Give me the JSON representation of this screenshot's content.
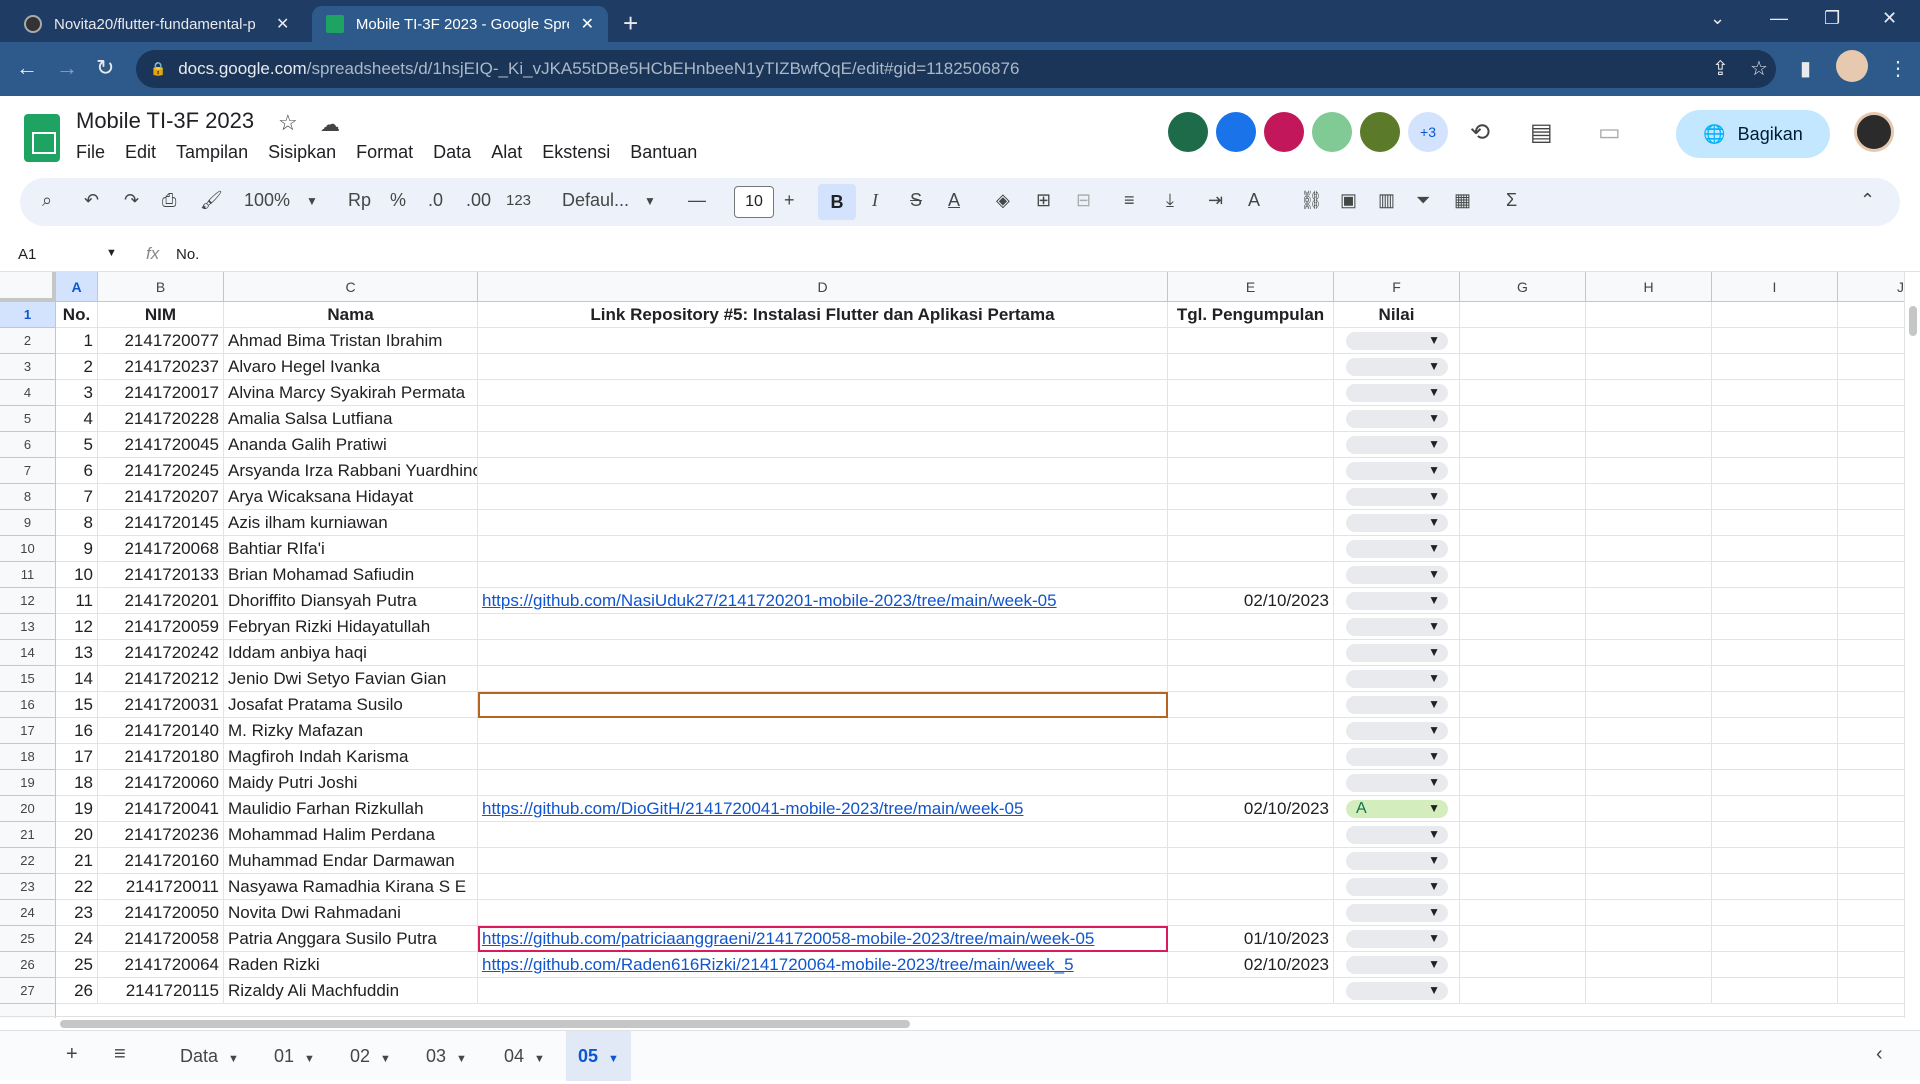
{
  "browser": {
    "tabs": [
      {
        "title": "Novita20/flutter-fundamental-p",
        "active": false
      },
      {
        "title": "Mobile TI-3F 2023 - Google Spre",
        "active": true
      }
    ],
    "url_host": "docs.google.com",
    "url_path": "/spreadsheets/d/1hsjEIQ-_Ki_vJKA55tDBe5HCbEHnbeeN1yTIZBwfQqE/edit#gid=1182506876"
  },
  "doc": {
    "title": "Mobile TI-3F 2023",
    "menus": [
      "File",
      "Edit",
      "Tampilan",
      "Sisipkan",
      "Format",
      "Data",
      "Alat",
      "Ekstensi",
      "Bantuan"
    ],
    "collab_more": "+3",
    "share_label": "Bagikan"
  },
  "toolbar": {
    "zoom": "100%",
    "currency": "Rp",
    "percent": "%",
    "dec_minus": ".0",
    "dec_plus": ".00",
    "number_format": "123",
    "font": "Defaul...",
    "font_size": "10"
  },
  "formula": {
    "cell_ref": "A1",
    "content": "No."
  },
  "columns": [
    "A",
    "B",
    "C",
    "D",
    "E",
    "F",
    "G",
    "H",
    "I",
    "J"
  ],
  "header_row": {
    "no": "No.",
    "nim": "NIM",
    "nama": "Nama",
    "link": "Link Repository #5: Instalasi Flutter dan Aplikasi Pertama",
    "tgl": "Tgl. Pengumpulan",
    "nilai": "Nilai"
  },
  "rows": [
    {
      "row": "2",
      "no": "1",
      "nim": "2141720077",
      "nama": "Ahmad Bima Tristan Ibrahim",
      "link": "",
      "tgl": "",
      "nilai": ""
    },
    {
      "row": "3",
      "no": "2",
      "nim": "2141720237",
      "nama": "Alvaro Hegel Ivanka",
      "link": "",
      "tgl": "",
      "nilai": ""
    },
    {
      "row": "4",
      "no": "3",
      "nim": "2141720017",
      "nama": "Alvina Marcy Syakirah Permata",
      "link": "",
      "tgl": "",
      "nilai": ""
    },
    {
      "row": "5",
      "no": "4",
      "nim": "2141720228",
      "nama": "Amalia Salsa Lutfiana",
      "link": "",
      "tgl": "",
      "nilai": ""
    },
    {
      "row": "6",
      "no": "5",
      "nim": "2141720045",
      "nama": "Ananda Galih Pratiwi",
      "link": "",
      "tgl": "",
      "nilai": ""
    },
    {
      "row": "7",
      "no": "6",
      "nim": "2141720245",
      "nama": "Arsyanda Irza Rabbani Yuardhino",
      "link": "",
      "tgl": "",
      "nilai": ""
    },
    {
      "row": "8",
      "no": "7",
      "nim": "2141720207",
      "nama": "Arya Wicaksana Hidayat",
      "link": "",
      "tgl": "",
      "nilai": ""
    },
    {
      "row": "9",
      "no": "8",
      "nim": "2141720145",
      "nama": "Azis ilham kurniawan",
      "link": "",
      "tgl": "",
      "nilai": ""
    },
    {
      "row": "10",
      "no": "9",
      "nim": "2141720068",
      "nama": "Bahtiar RIfa'i",
      "link": "",
      "tgl": "",
      "nilai": ""
    },
    {
      "row": "11",
      "no": "10",
      "nim": "2141720133",
      "nama": "Brian Mohamad Safiudin",
      "link": "",
      "tgl": "",
      "nilai": ""
    },
    {
      "row": "12",
      "no": "11",
      "nim": "2141720201",
      "nama": "Dhoriffito Diansyah Putra",
      "link": "https://github.com/NasiUduk27/2141720201-mobile-2023/tree/main/week-05",
      "tgl": "02/10/2023",
      "nilai": ""
    },
    {
      "row": "13",
      "no": "12",
      "nim": "2141720059",
      "nama": "Febryan Rizki Hidayatullah",
      "link": "",
      "tgl": "",
      "nilai": ""
    },
    {
      "row": "14",
      "no": "13",
      "nim": "2141720242",
      "nama": "Iddam anbiya haqi",
      "link": "",
      "tgl": "",
      "nilai": ""
    },
    {
      "row": "15",
      "no": "14",
      "nim": "2141720212",
      "nama": "Jenio Dwi Setyo Favian Gian",
      "link": "",
      "tgl": "",
      "nilai": ""
    },
    {
      "row": "16",
      "no": "15",
      "nim": "2141720031",
      "nama": "Josafat Pratama Susilo",
      "link": "",
      "tgl": "",
      "nilai": ""
    },
    {
      "row": "17",
      "no": "16",
      "nim": "2141720140",
      "nama": "M. Rizky Mafazan",
      "link": "",
      "tgl": "",
      "nilai": ""
    },
    {
      "row": "18",
      "no": "17",
      "nim": "2141720180",
      "nama": "Magfiroh Indah Karisma",
      "link": "",
      "tgl": "",
      "nilai": ""
    },
    {
      "row": "19",
      "no": "18",
      "nim": "2141720060",
      "nama": "Maidy Putri Joshi",
      "link": "",
      "tgl": "",
      "nilai": ""
    },
    {
      "row": "20",
      "no": "19",
      "nim": "2141720041",
      "nama": "Maulidio Farhan Rizkullah",
      "link": "https://github.com/DioGitH/2141720041-mobile-2023/tree/main/week-05",
      "tgl": "02/10/2023",
      "nilai": "A"
    },
    {
      "row": "21",
      "no": "20",
      "nim": "2141720236",
      "nama": "Mohammad Halim Perdana",
      "link": "",
      "tgl": "",
      "nilai": ""
    },
    {
      "row": "22",
      "no": "21",
      "nim": "2141720160",
      "nama": "Muhammad Endar Darmawan",
      "link": "",
      "tgl": "",
      "nilai": ""
    },
    {
      "row": "23",
      "no": "22",
      "nim": "2141720011",
      "nama": "Nasyawa Ramadhia Kirana S E",
      "link": "",
      "tgl": "",
      "nilai": ""
    },
    {
      "row": "24",
      "no": "23",
      "nim": "2141720050",
      "nama": "Novita Dwi Rahmadani",
      "link": "",
      "tgl": "",
      "nilai": ""
    },
    {
      "row": "25",
      "no": "24",
      "nim": "2141720058",
      "nama": "Patria Anggara Susilo Putra",
      "link": "https://github.com/patriciaanggraeni/2141720058-mobile-2023/tree/main/week-05",
      "tgl": "01/10/2023",
      "nilai": ""
    },
    {
      "row": "26",
      "no": "25",
      "nim": "2141720064",
      "nama": "Raden Rizki",
      "link": "https://github.com/Raden616Rizki/2141720064-mobile-2023/tree/main/week_5",
      "tgl": "02/10/2023",
      "nilai": ""
    },
    {
      "row": "27",
      "no": "26",
      "nim": "2141720115",
      "nama": "Rizaldy Ali Machfuddin",
      "link": "",
      "tgl": "",
      "nilai": ""
    }
  ],
  "sheets": [
    "Data",
    "01",
    "02",
    "03",
    "04",
    "05"
  ],
  "active_sheet": "05",
  "colors": {
    "sheets_green": "#1ea362",
    "link_blue": "#1155cc",
    "nilai_green": "#d4edbc"
  }
}
